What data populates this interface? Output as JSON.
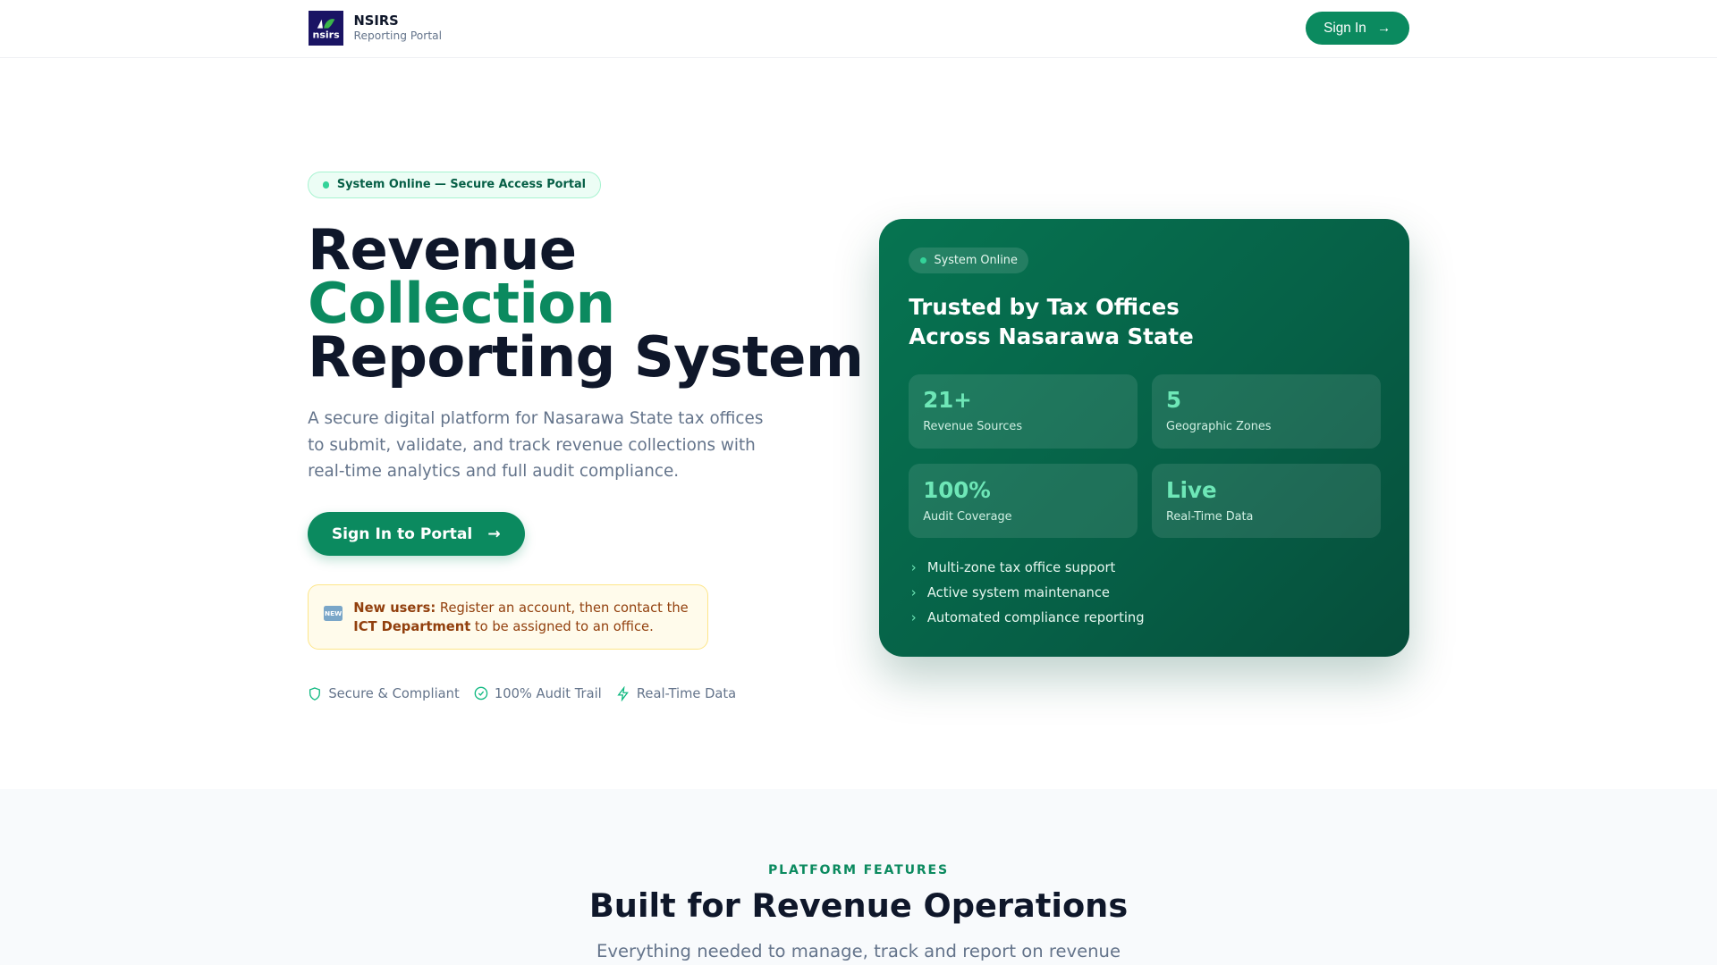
{
  "header": {
    "brand": "NSIRS",
    "subtitle": "Reporting Portal",
    "logo_text": "nsirs",
    "sign_in": "Sign In"
  },
  "hero": {
    "status_pill": "System Online — Secure Access Portal",
    "title_line1": "Revenue",
    "title_line2": "Collection",
    "title_line3": "Reporting System",
    "description": "A secure digital platform for Nasarawa State tax offices to submit, validate, and track revenue collections with real-time analytics and full audit compliance.",
    "cta": "Sign In to Portal",
    "notice": {
      "icon_label": "NEW",
      "bold1": "New users:",
      "text1": " Register an account, then contact the ",
      "bold2": "ICT Department",
      "text2": " to be assigned to an office."
    },
    "trust": [
      "Secure & Compliant",
      "100% Audit Trail",
      "Real-Time Data"
    ]
  },
  "card": {
    "status": "System Online",
    "title_line1": "Trusted by Tax Offices",
    "title_line2": "Across Nasarawa State",
    "stats": [
      {
        "value": "21+",
        "label": "Revenue Sources"
      },
      {
        "value": "5",
        "label": "Geographic Zones"
      },
      {
        "value": "100%",
        "label": "Audit Coverage"
      },
      {
        "value": "Live",
        "label": "Real-Time Data"
      }
    ],
    "features": [
      "Multi-zone tax office support",
      "Active system maintenance",
      "Automated compliance reporting"
    ]
  },
  "features_section": {
    "kicker": "PLATFORM FEATURES",
    "title": "Built for Revenue Operations",
    "subtitle": "Everything needed to manage, track and report on revenue"
  },
  "colors": {
    "accent": "#0b8a5f",
    "card": "#065f46",
    "highlight": "#6ee7b7"
  }
}
